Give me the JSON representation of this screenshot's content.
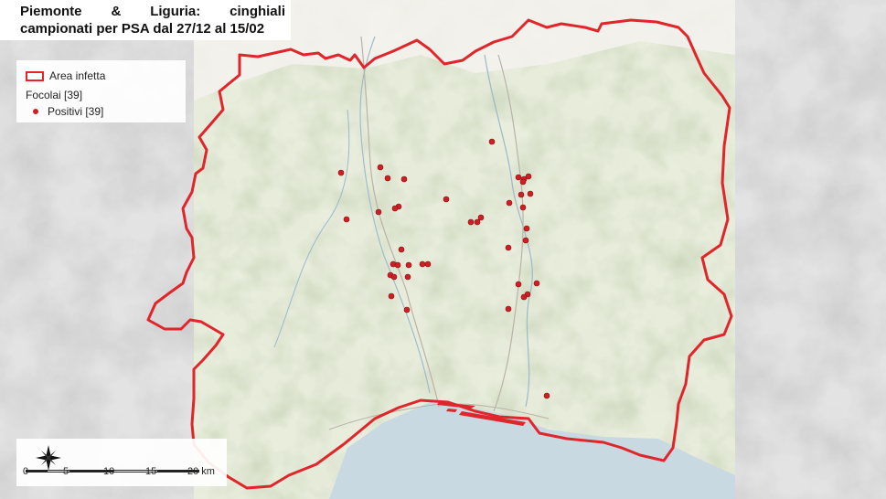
{
  "title": {
    "line1": "Piemonte & Liguria: cinghiali",
    "line2": "campionati per PSA dal 27/12 al 15/02"
  },
  "legend": {
    "area_label": "Area infetta",
    "group_label": "Focolai [39]",
    "positive_label": "Positivi [39]"
  },
  "scale": {
    "ticks": [
      "0",
      "5",
      "10",
      "15",
      "20 km"
    ]
  },
  "icons": {
    "compass": "north-arrow-compass-icon"
  },
  "colors": {
    "area_border": "#e0252b",
    "positive_dot": "#d01f24",
    "sea": "#c9d9e2",
    "land": "#e6ecd6"
  }
}
